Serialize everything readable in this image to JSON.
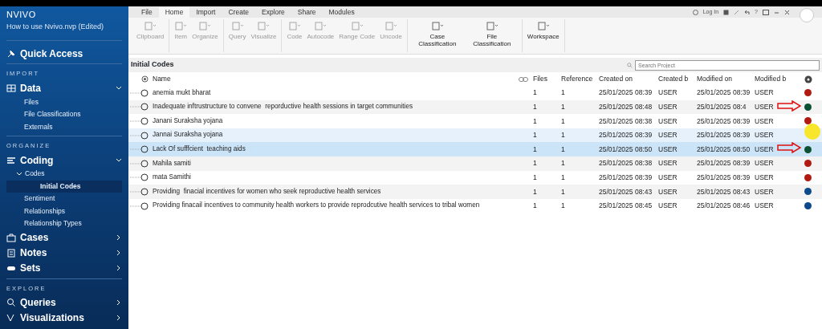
{
  "sidebar": {
    "app_title": "NVIVO",
    "project": "How to use Nvivo.nvp (Edited)",
    "items": [
      {
        "kind": "main",
        "label": "Quick Access"
      },
      {
        "kind": "heading",
        "label": "IMPORT"
      },
      {
        "kind": "main",
        "label": "Data",
        "expanded": true,
        "children": [
          {
            "kind": "sub",
            "label": "Files",
            "selected": false
          },
          {
            "kind": "sub",
            "label": "File Classifications",
            "selected": false
          },
          {
            "kind": "sub",
            "label": "Externals",
            "selected": false
          }
        ]
      },
      {
        "kind": "heading",
        "label": "ORGANIZE"
      },
      {
        "kind": "main",
        "label": "Coding",
        "expanded": true,
        "children": [
          {
            "kind": "sub",
            "label": "Codes",
            "expanded": true,
            "selected": false,
            "children": [
              {
                "kind": "sub",
                "label": "Initial Codes",
                "selected": true
              }
            ]
          },
          {
            "kind": "sub",
            "label": "Sentiment",
            "selected": false
          },
          {
            "kind": "sub",
            "label": "Relationships",
            "selected": false
          },
          {
            "kind": "sub",
            "label": "Relationship Types",
            "selected": false
          }
        ]
      },
      {
        "kind": "main",
        "label": "Cases",
        "expanded": false
      },
      {
        "kind": "main",
        "label": "Notes",
        "expanded": false
      },
      {
        "kind": "main",
        "label": "Sets",
        "expanded": false
      },
      {
        "kind": "heading",
        "label": "EXPLORE"
      },
      {
        "kind": "main",
        "label": "Queries",
        "expanded": false
      },
      {
        "kind": "main",
        "label": "Visualizations",
        "expanded": false
      }
    ]
  },
  "ribbon": {
    "tabs": [
      {
        "label": "File",
        "selected": false
      },
      {
        "label": "Home",
        "selected": true
      },
      {
        "label": "Import",
        "selected": false
      },
      {
        "label": "Create",
        "selected": false
      },
      {
        "label": "Explore",
        "selected": false
      },
      {
        "label": "Share",
        "selected": false
      },
      {
        "label": "Modules",
        "selected": false
      }
    ],
    "login": "Log In",
    "help": "?",
    "groups": [
      [
        {
          "label": "Clipboard",
          "disabled": true
        }
      ],
      [
        {
          "label": "Item",
          "disabled": true
        },
        {
          "label": "Organize",
          "disabled": true
        }
      ],
      [
        {
          "label": "Query",
          "disabled": true
        },
        {
          "label": "Visualize",
          "disabled": true
        }
      ],
      [
        {
          "label": "Code",
          "disabled": true
        },
        {
          "label": "Autocode",
          "disabled": true
        },
        {
          "label": "Range Code",
          "disabled": true
        },
        {
          "label": "Uncode",
          "disabled": true
        }
      ],
      [
        {
          "label": "Case Classification",
          "disabled": false
        },
        {
          "label": "File Classification",
          "disabled": false
        }
      ],
      [
        {
          "label": "Workspace",
          "disabled": false
        }
      ]
    ]
  },
  "view": {
    "title": "Initial Codes",
    "search": {
      "placeholder": "Search Project"
    },
    "columns": [
      "Name",
      "Files",
      "Reference",
      "Created on",
      "Created b",
      "Modified on",
      "Modified b"
    ],
    "rows": [
      {
        "name": "anemia mukt bharat",
        "files": "1",
        "references": "1",
        "created_on": "25/01/2025 08:39",
        "created_by": "USER",
        "modified_on": "25/01/2025 08:39",
        "modified_by": "USER",
        "color": "#b01a10",
        "selected": false,
        "hovered": false,
        "arrow": false
      },
      {
        "name": "Inadequate inftrustructure to convene  reporductive health sessions in target communities",
        "files": "1",
        "references": "1",
        "created_on": "25/01/2025 08:48",
        "created_by": "USER",
        "modified_on": "25/01/2025 08:4",
        "modified_by": "USER",
        "color": "#0b5234",
        "selected": false,
        "hovered": false,
        "arrow": true
      },
      {
        "name": "Janani Suraksha yojana",
        "files": "1",
        "references": "1",
        "created_on": "25/01/2025 08:38",
        "created_by": "USER",
        "modified_on": "25/01/2025 08:39",
        "modified_by": "USER",
        "color": "#b01a10",
        "selected": false,
        "hovered": false,
        "arrow": false
      },
      {
        "name": "Jannai Suraksha yojana",
        "files": "1",
        "references": "1",
        "created_on": "25/01/2025 08:39",
        "created_by": "USER",
        "modified_on": "25/01/2025 08:39",
        "modified_by": "USER",
        "selected": false,
        "hovered": true,
        "arrow": false,
        "cursor": true
      },
      {
        "name": "Lack Of sufffcient  teaching aids",
        "files": "1",
        "references": "1",
        "created_on": "25/01/2025 08:50",
        "created_by": "USER",
        "modified_on": "25/01/2025 08:50",
        "modified_by": "USER",
        "color": "#0b5234",
        "selected": true,
        "hovered": false,
        "arrow": true
      },
      {
        "name": "Mahila samiti",
        "files": "1",
        "references": "1",
        "created_on": "25/01/2025 08:38",
        "created_by": "USER",
        "modified_on": "25/01/2025 08:39",
        "modified_by": "USER",
        "color": "#b01a10",
        "selected": false,
        "hovered": false,
        "arrow": false
      },
      {
        "name": "mata Samithi",
        "files": "1",
        "references": "1",
        "created_on": "25/01/2025 08:39",
        "created_by": "USER",
        "modified_on": "25/01/2025 08:39",
        "modified_by": "USER",
        "color": "#b01a10",
        "selected": false,
        "hovered": false,
        "arrow": false
      },
      {
        "name": "Providing  finacial incentives for women who seek reproductive health services",
        "files": "1",
        "references": "1",
        "created_on": "25/01/2025 08:43",
        "created_by": "USER",
        "modified_on": "25/01/2025 08:43",
        "modified_by": "USER",
        "color": "#0d4a8c",
        "selected": false,
        "hovered": false,
        "arrow": false
      },
      {
        "name": "Providing finacail incentives to community health workers to provide reprodcutive health services to tribal women",
        "files": "1",
        "references": "1",
        "created_on": "25/01/2025 08:45",
        "created_by": "USER",
        "modified_on": "25/01/2025 08:46",
        "modified_by": "USER",
        "color": "#0d4a8c",
        "selected": false,
        "hovered": false,
        "arrow": false
      }
    ]
  }
}
